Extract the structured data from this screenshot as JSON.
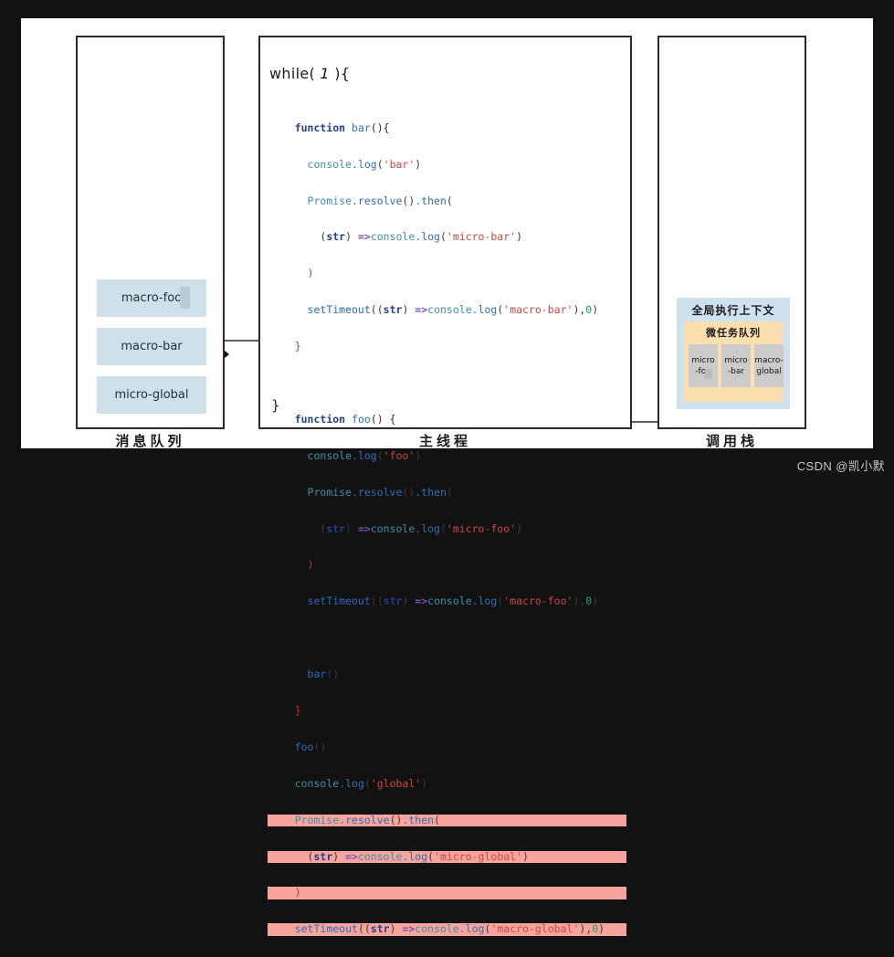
{
  "watermark": "CSDN @凯小默",
  "panels": {
    "queue": {
      "caption": "消息队列",
      "items": [
        {
          "label": "macro-foo"
        },
        {
          "label": "macro-bar"
        },
        {
          "label": "micro-global"
        }
      ]
    },
    "main_thread": {
      "caption": "主线程",
      "loop_header": "while( 1 ){",
      "loop_footer": "}",
      "code_lines": [
        "function bar(){",
        "  console.log('bar')",
        "  Promise.resolve().then(",
        "    (str) =>console.log('micro-bar')",
        "  )",
        "  setTimeout((str) =>console.log('macro-bar'),0)",
        "}",
        "",
        "function foo() {",
        "  console.log('foo')",
        "  Promise.resolve().then(",
        "    (str) =>console.log('micro-foo')",
        "  )",
        "  setTimeout((str) =>console.log('macro-foo'),0)",
        "",
        "  bar()",
        "}",
        "foo()",
        "console.log('global')",
        "Promise.resolve().then(",
        "  (str) =>console.log('micro-global')",
        ")",
        "setTimeout((str) =>console.log('macro-global'),0)"
      ],
      "highlighted_lines": [
        "Promise.resolve().then(",
        "  (str) =>console.log('micro-global')",
        ")",
        "setTimeout((str) =>console.log('macro-global'),0)"
      ],
      "highlight_color": "#f6a49c"
    },
    "call_stack": {
      "caption": "调用栈",
      "context_title": "全局执行上下文",
      "context_color": "#cfe0ef",
      "microtask_title": "微任务队列",
      "microtask_color": "#fbdfae",
      "microtask_items": [
        {
          "line1": "micro",
          "line2": "-foo"
        },
        {
          "line1": "micro",
          "line2": "-bar"
        },
        {
          "line1": "macro-",
          "line2": "global"
        }
      ]
    }
  },
  "colors": {
    "background": "#121212",
    "canvas": "#ffffff",
    "stroke": "#2b2b2b",
    "queue_item": "#cfe0eb",
    "micro_item": "#cbcbcb"
  }
}
